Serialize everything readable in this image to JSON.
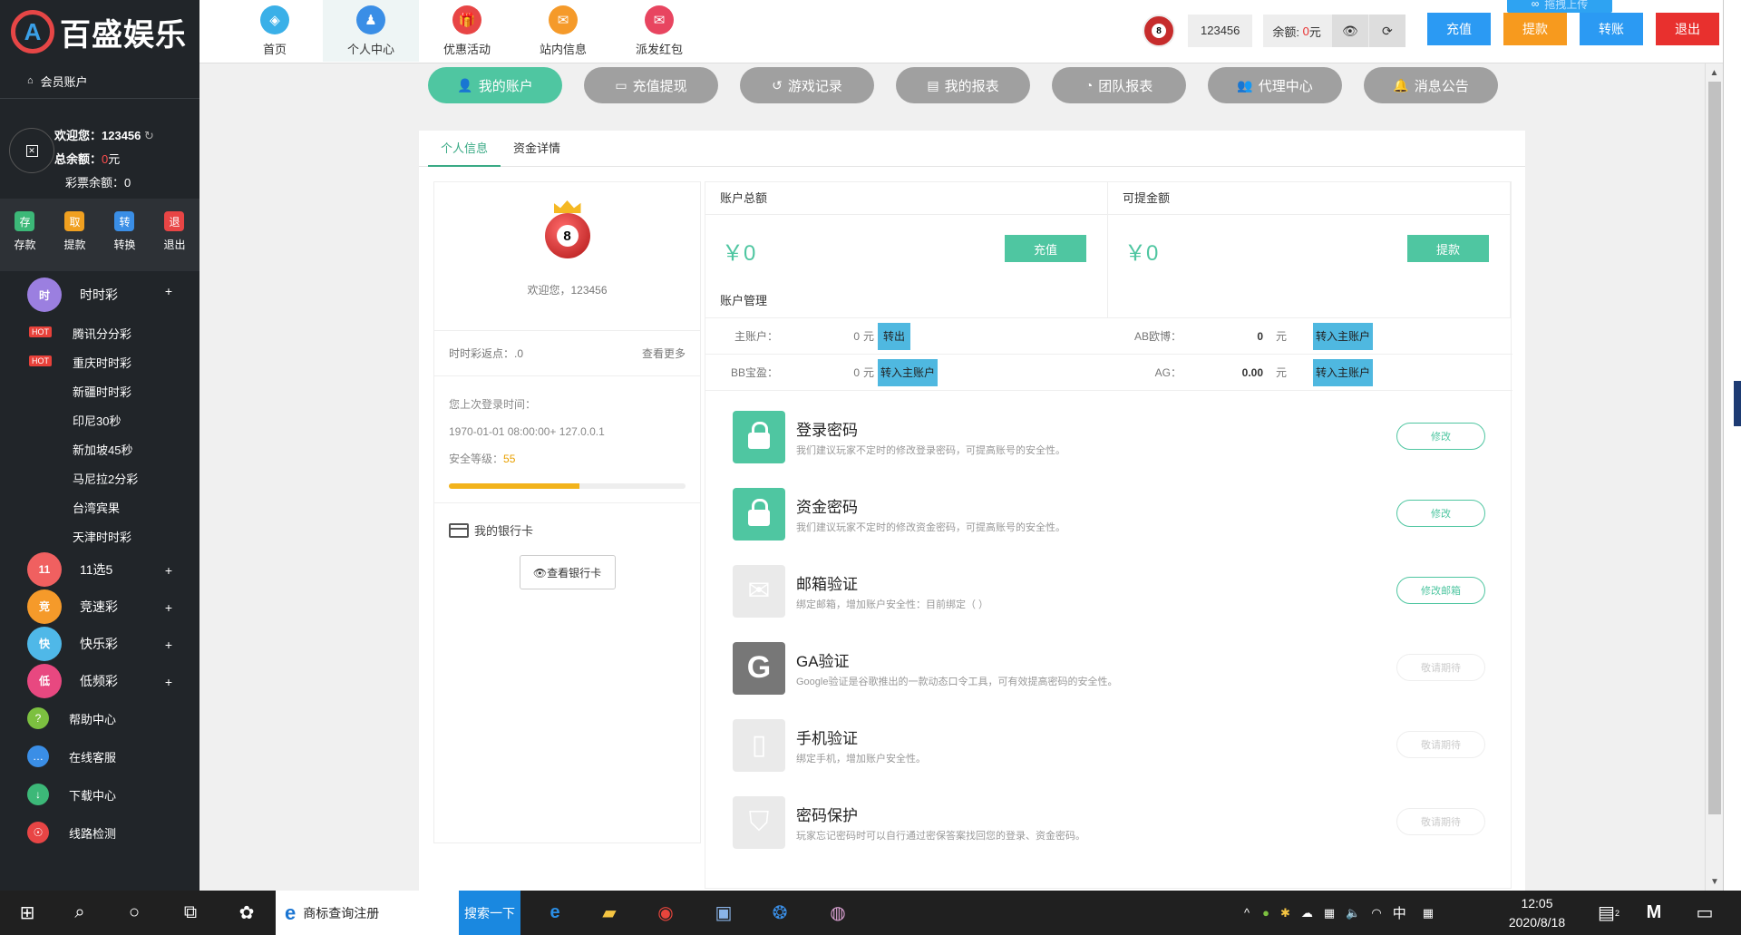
{
  "brand": {
    "logo_letter": "A",
    "name": "百盛娱乐"
  },
  "sidebar": {
    "member_account": "会员账户",
    "welcome_label": "欢迎您：",
    "username": "123456",
    "total_label": "总余额：",
    "total_value": "0",
    "total_unit": "元",
    "lottery_balance": "彩票余额：0",
    "quick_actions": [
      {
        "icon": "存",
        "label": "存款",
        "color": "#3cb878"
      },
      {
        "icon": "取",
        "label": "提款",
        "color": "#f0a020"
      },
      {
        "icon": "转",
        "label": "转换",
        "color": "#3a8ee6"
      },
      {
        "icon": "退",
        "label": "退出",
        "color": "#e84545"
      }
    ],
    "categories": [
      {
        "label": "时时彩",
        "icon": "时",
        "color": "#9b7fe0"
      },
      {
        "label": "11选5",
        "icon": "11",
        "color": "#f06060"
      },
      {
        "label": "竞速彩",
        "icon": "竞",
        "color": "#f59a2a"
      },
      {
        "label": "快乐彩",
        "icon": "快",
        "color": "#4fb8e8"
      },
      {
        "label": "低频彩",
        "icon": "低",
        "color": "#e84880"
      }
    ],
    "sub_items": [
      {
        "label": "腾讯分分彩",
        "hot": "HOT"
      },
      {
        "label": "重庆时时彩",
        "hot": "HOT"
      },
      {
        "label": "新疆时时彩",
        "hot": ""
      },
      {
        "label": "印尼30秒",
        "hot": ""
      },
      {
        "label": "新加坡45秒",
        "hot": ""
      },
      {
        "label": "马尼拉2分彩",
        "hot": ""
      },
      {
        "label": "台湾宾果",
        "hot": ""
      },
      {
        "label": "天津时时彩",
        "hot": ""
      }
    ],
    "links": [
      {
        "label": "帮助中心",
        "icon": "?",
        "color": "#7cc040"
      },
      {
        "label": "在线客服",
        "icon": "…",
        "color": "#3a8ee6"
      },
      {
        "label": "下载中心",
        "icon": "↓",
        "color": "#3cb878"
      },
      {
        "label": "线路检测",
        "icon": "☉",
        "color": "#e84545"
      }
    ]
  },
  "top_nav": [
    {
      "label": "首页",
      "icon": "home-icon",
      "glyph": "◈",
      "color": "#3ab0e8"
    },
    {
      "label": "个人中心",
      "icon": "user-icon",
      "glyph": "♟",
      "color": "#3a8ee6"
    },
    {
      "label": "优惠活动",
      "icon": "gift-icon",
      "glyph": "🎁",
      "color": "#e84545"
    },
    {
      "label": "站内信息",
      "icon": "message-icon",
      "glyph": "✉",
      "color": "#f59a2a"
    },
    {
      "label": "派发红包",
      "icon": "redpacket-icon",
      "glyph": "✉",
      "color": "#e84560"
    }
  ],
  "header": {
    "username": "123456",
    "balance_label": "余额:",
    "balance_value": "0",
    "balance_unit": "元",
    "upload_label": "拖拽上传",
    "buttons": [
      {
        "label": "充值",
        "color": "#2b9af3"
      },
      {
        "label": "提款",
        "color": "#f79a1e"
      },
      {
        "label": "转账",
        "color": "#2b9af3"
      },
      {
        "label": "退出",
        "color": "#e8302e"
      }
    ]
  },
  "subnav": [
    {
      "label": "我的账户",
      "glyph": "👤"
    },
    {
      "label": "充值提现",
      "glyph": "▭"
    },
    {
      "label": "游戏记录",
      "glyph": "↺"
    },
    {
      "label": "我的报表",
      "glyph": "▤"
    },
    {
      "label": "团队报表",
      "glyph": "◔"
    },
    {
      "label": "代理中心",
      "glyph": "👥"
    },
    {
      "label": "消息公告",
      "glyph": "🔔"
    }
  ],
  "tabs": [
    "个人信息",
    "资金详情"
  ],
  "profile": {
    "welcome": "欢迎您，123456",
    "rebate_label": "时时彩返点：.0",
    "more": "查看更多",
    "last_login_label": "您上次登录时间：",
    "last_login_value": "1970-01-01 08:00:00+ 127.0.0.1",
    "security_label": "安全等级：",
    "security_value": "55",
    "security_percent": 55,
    "bank_title": "我的银行卡",
    "bank_button": "👁查看银行卡"
  },
  "balances": {
    "total": {
      "title": "账户总额",
      "amount": "￥0",
      "button": "充值"
    },
    "withdrawable": {
      "title": "可提金额",
      "amount": "￥0",
      "button": "提款"
    },
    "manage_title": "账户管理"
  },
  "accounts": [
    [
      {
        "label": "主账户：",
        "value": "0",
        "unit": "元",
        "button": "转出"
      },
      {
        "label": "AB欧博：",
        "value": "0",
        "unit": "元",
        "button": "转入主账户"
      }
    ],
    [
      {
        "label": "BB宝盈：",
        "value": "0",
        "unit": "元",
        "button": "转入主账户"
      },
      {
        "label": "AG：",
        "value": "0.00",
        "unit": "元",
        "button": "转入主账户"
      }
    ]
  ],
  "security": [
    {
      "title": "登录密码",
      "desc": "我们建议玩家不定时的修改登录密码，可提高账号的安全性。",
      "button": "修改",
      "enabled": true,
      "color": "#4fc6a1",
      "icon": "lock-icon"
    },
    {
      "title": "资金密码",
      "desc": "我们建议玩家不定时的修改资金密码，可提高账号的安全性。",
      "button": "修改",
      "enabled": true,
      "color": "#4fc6a1",
      "icon": "lock-icon"
    },
    {
      "title": "邮箱验证",
      "desc": "绑定邮箱，增加账户安全性：目前绑定（ ）",
      "button": "修改邮箱",
      "enabled": true,
      "color": "#eaeaea",
      "icon": "mail-icon"
    },
    {
      "title": "GA验证",
      "desc": "Google验证是谷歌推出的一款动态口令工具，可有效提高密码的安全性。",
      "button": "敬请期待",
      "enabled": false,
      "color": "#777777",
      "icon": "google-icon"
    },
    {
      "title": "手机验证",
      "desc": "绑定手机，增加账户安全性。",
      "button": "敬请期待",
      "enabled": false,
      "color": "#eaeaea",
      "icon": "phone-icon"
    },
    {
      "title": "密码保护",
      "desc": "玩家忘记密码时可以自行通过密保答案找回您的登录、资金密码。",
      "button": "敬请期待",
      "enabled": false,
      "color": "#eaeaea",
      "icon": "shield-icon"
    }
  ],
  "taskbar": {
    "search_text": "商标查询注册",
    "search_button": "搜索一下",
    "ime": "中",
    "time": "12:05",
    "date": "2020/8/18",
    "notif_count": "2"
  }
}
